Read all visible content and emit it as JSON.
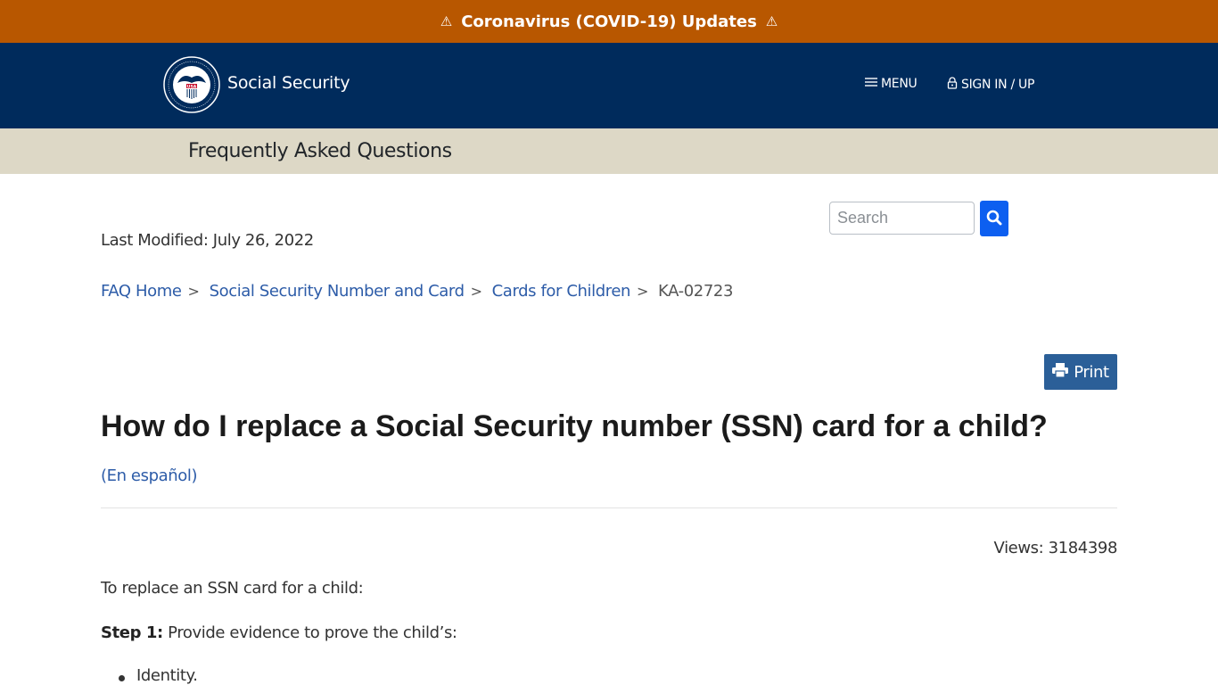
{
  "alert": {
    "text": "Coronavirus (COVID-19) Updates",
    "icon": "warning-icon",
    "color": "#b85700"
  },
  "header": {
    "site_name": "Social Security",
    "logo_text_top": "SOCIAL SECURITY",
    "logo_text_bottom": "ADMINISTRATION",
    "logo_badge": "USA",
    "menu_label": "MENU",
    "sign_in_label": "SIGN IN / UP",
    "color": "#002b5c"
  },
  "faq_bar": {
    "title": "Frequently Asked Questions"
  },
  "search": {
    "placeholder": "Search",
    "value": ""
  },
  "meta": {
    "last_modified": "Last Modified: July 26, 2022",
    "views": "Views: 3184398"
  },
  "breadcrumb": {
    "items": [
      {
        "label": "FAQ Home"
      },
      {
        "label": "Social Security Number and Card"
      },
      {
        "label": "Cards for Children"
      }
    ],
    "separator": ">",
    "current": "KA-02723"
  },
  "print_label": "Print",
  "article": {
    "title": "How do I replace a Social Security number (SSN) card for a child?",
    "spanish_link": "(En español)",
    "intro": "To replace an SSN card for a child:",
    "step1_label": "Step 1:",
    "step1_text": " Provide evidence to prove the child’s:",
    "bullets": [
      "Identity."
    ]
  }
}
